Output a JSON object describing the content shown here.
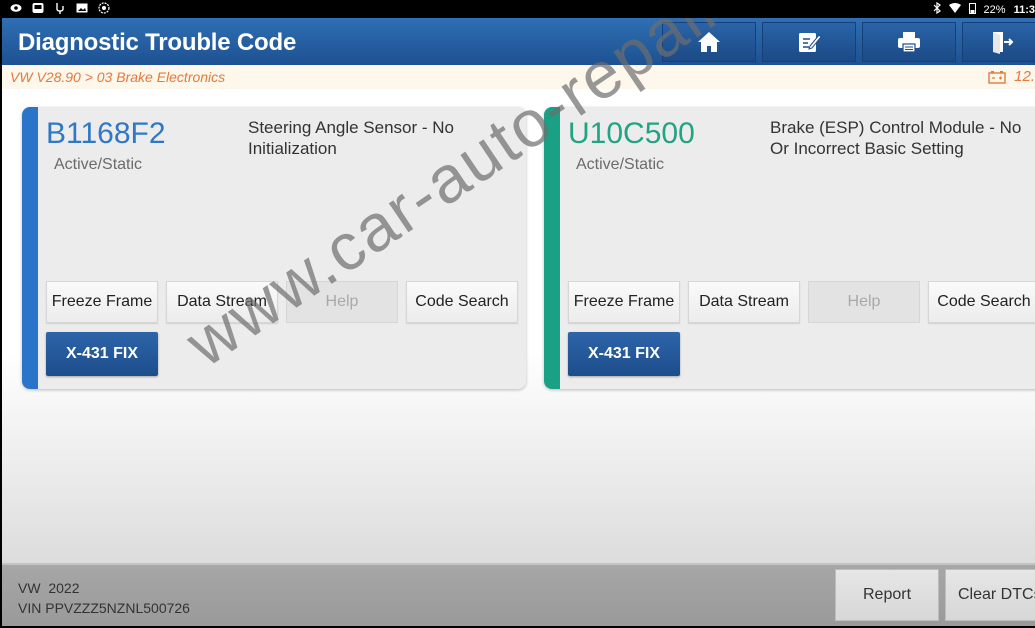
{
  "status_bar": {
    "left_icons": [
      "eye-icon",
      "screen-icon",
      "usb-icon",
      "image-icon",
      "camera-icon"
    ],
    "battery_percent": "22%",
    "time": "11:3"
  },
  "header": {
    "title": "Diagnostic Trouble Code",
    "toolbar": [
      {
        "name": "home-button",
        "icon": "home-icon"
      },
      {
        "name": "edit-button",
        "icon": "edit-icon"
      },
      {
        "name": "print-button",
        "icon": "printer-icon"
      },
      {
        "name": "exit-button",
        "icon": "exit-icon"
      }
    ]
  },
  "breadcrumb": {
    "path": "VW V28.90 > 03 Brake Electronics",
    "voltage": "12."
  },
  "colors": {
    "header_blue": "#2463a6",
    "card1_accent": "#2a74c9",
    "card2_accent": "#1aa084",
    "crumb_orange": "#e27a3c"
  },
  "dtcs": [
    {
      "code": "B1168F2",
      "status": "Active/Static",
      "description": "Steering Angle Sensor - No Initialization",
      "buttons": [
        "Freeze Frame",
        "Data Stream",
        "Help",
        "Code Search"
      ],
      "fix_label": "X-431 FIX"
    },
    {
      "code": "U10C500",
      "status": "Active/Static",
      "description": "Brake (ESP) Control Module - No Or Incorrect Basic Setting",
      "buttons": [
        "Freeze Frame",
        "Data Stream",
        "Help",
        "Code Search"
      ],
      "fix_label": "X-431 FIX"
    }
  ],
  "footer": {
    "vehicle": "VW  2022",
    "vin": "VIN PPVZZZ5NZNL500726",
    "report_label": "Report",
    "clear_label": "Clear DTCs"
  },
  "watermark": "www.car-auto-repair.com"
}
